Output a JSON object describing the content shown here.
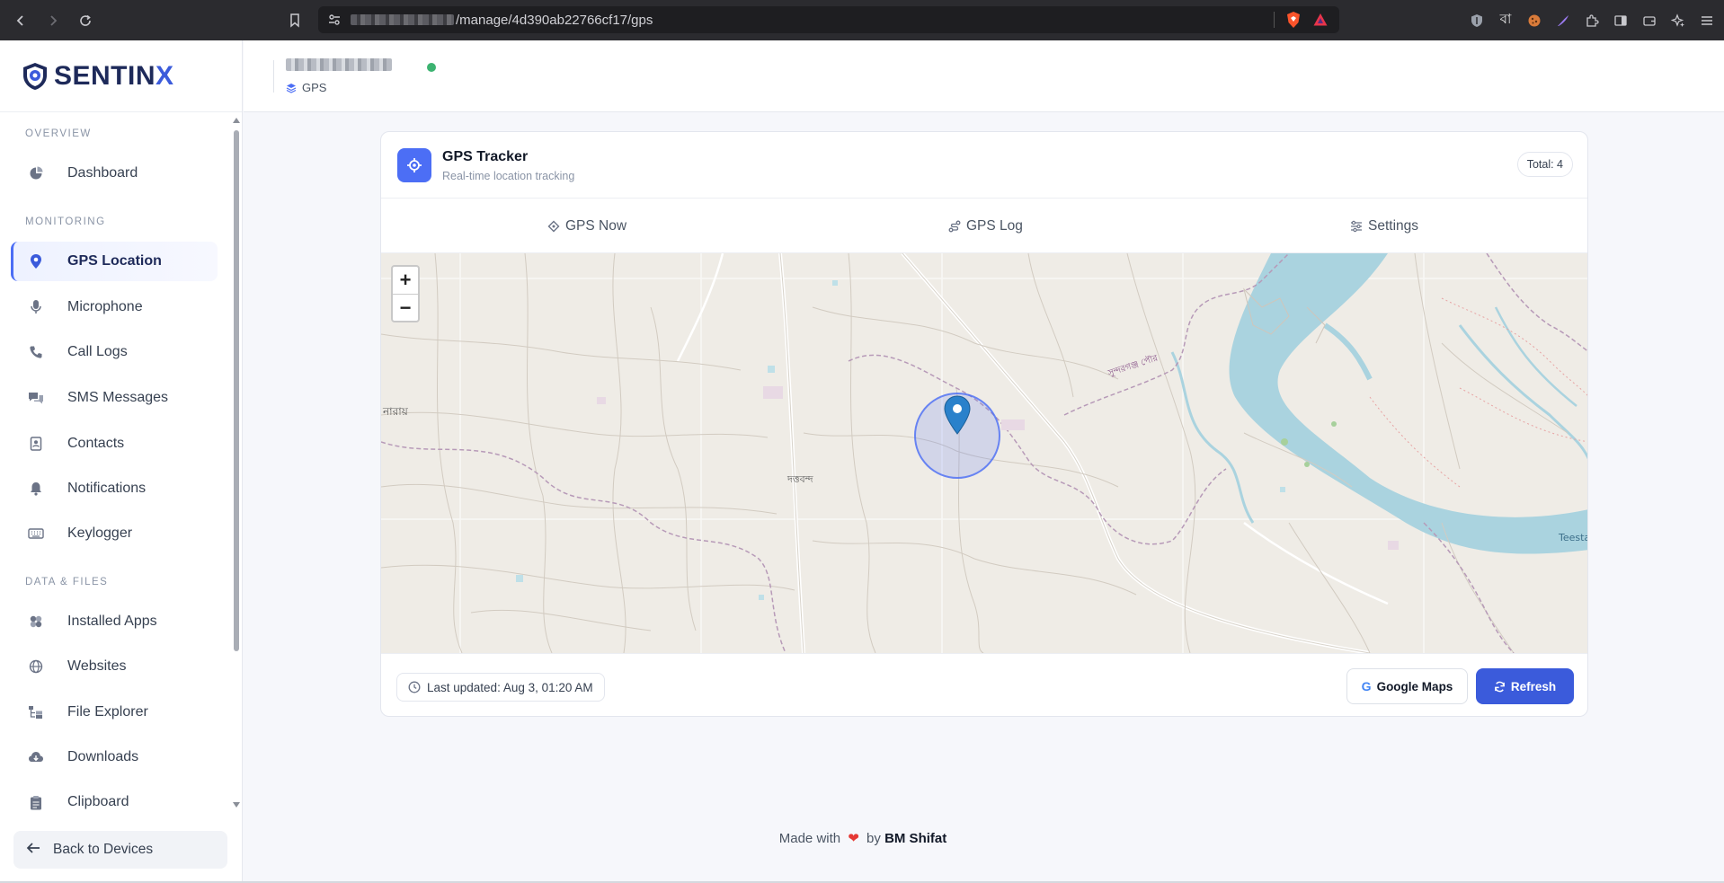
{
  "browser": {
    "url_path": "/manage/4d390ab22766cf17/gps"
  },
  "sidebar": {
    "logo": "SENTINX",
    "sections": {
      "overview": "OVERVIEW",
      "monitoring": "MONITORING",
      "data_files": "DATA & FILES"
    },
    "items": [
      {
        "label": "Dashboard",
        "icon": "pie-chart-icon"
      },
      {
        "label": "GPS Location",
        "icon": "map-pin-icon",
        "active": true
      },
      {
        "label": "Microphone",
        "icon": "microphone-icon"
      },
      {
        "label": "Call Logs",
        "icon": "phone-icon"
      },
      {
        "label": "SMS Messages",
        "icon": "chat-icon"
      },
      {
        "label": "Contacts",
        "icon": "address-book-icon"
      },
      {
        "label": "Notifications",
        "icon": "bell-icon"
      },
      {
        "label": "Keylogger",
        "icon": "keyboard-icon"
      },
      {
        "label": "Installed Apps",
        "icon": "apps-icon"
      },
      {
        "label": "Websites",
        "icon": "globe-icon"
      },
      {
        "label": "File Explorer",
        "icon": "folder-tree-icon"
      },
      {
        "label": "Downloads",
        "icon": "cloud-download-icon"
      },
      {
        "label": "Clipboard",
        "icon": "clipboard-icon"
      }
    ],
    "back_label": "Back to Devices"
  },
  "header": {
    "breadcrumb": "GPS",
    "status_color": "#3cb371"
  },
  "card": {
    "title": "GPS Tracker",
    "subtitle": "Real-time location tracking",
    "total": "Total: 4",
    "tabs": [
      {
        "label": "GPS Now",
        "icon": "crosshair-icon"
      },
      {
        "label": "GPS Log",
        "icon": "route-icon"
      },
      {
        "label": "Settings",
        "icon": "sliders-icon"
      }
    ],
    "map": {
      "zoom_in": "+",
      "zoom_out": "−",
      "labels": [
        "নারায়",
        "দত্তবন্দ",
        "সুন্দরগঞ্জ পৌর",
        "Teesta"
      ]
    },
    "last_updated": "Last updated: Aug 3, 01:20 AM",
    "google_maps_label": "Google Maps",
    "google_letter": "G",
    "refresh_label": "Refresh"
  },
  "footer": {
    "made_with": "Made with",
    "heart": "❤",
    "by": "by",
    "author": "BM Shifat"
  },
  "colors": {
    "accent": "#3b5bdb",
    "map_water": "#aad3df",
    "map_land": "#efece6"
  }
}
